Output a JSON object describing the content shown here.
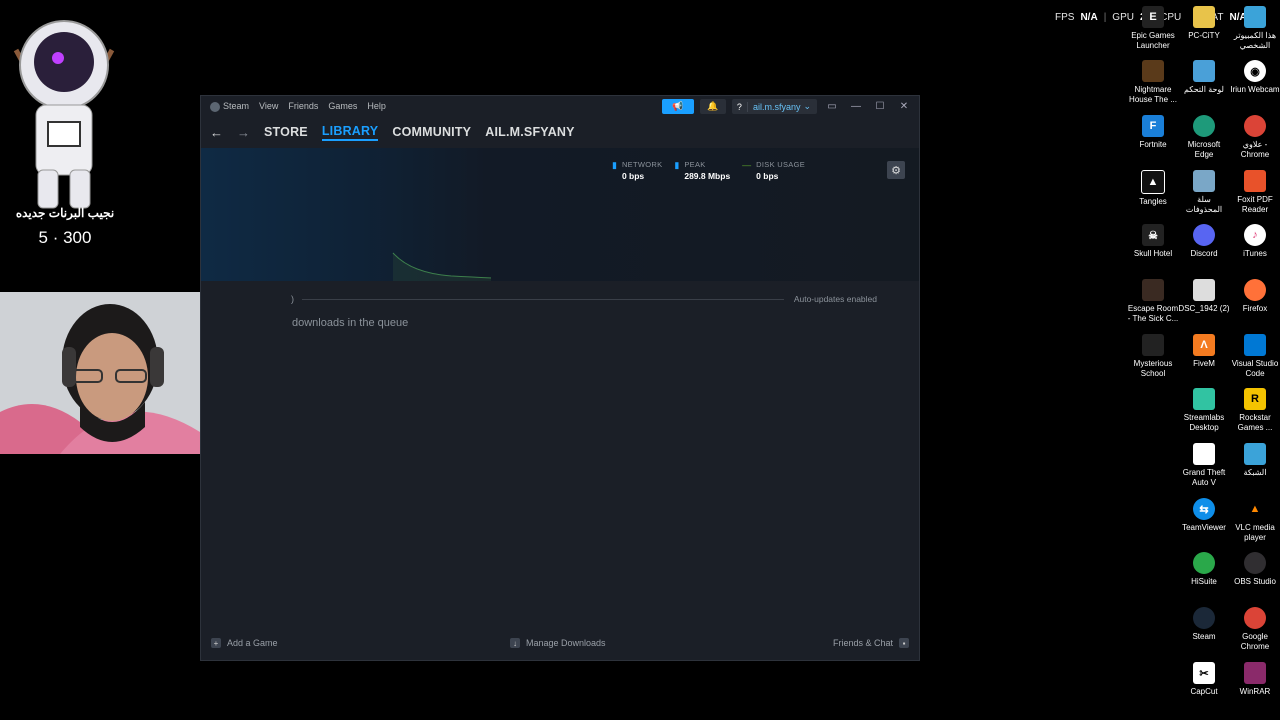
{
  "overlay": {
    "fps_label": "FPS",
    "fps_value": "N/A",
    "gpu_label": "GPU",
    "gpu_value": "2",
    "cpu_label": "CPU",
    "lat_label": "LAT",
    "lat_value": "N/A"
  },
  "mascot": {
    "caption": "نجيب البرنات جديده",
    "count": "5 · 300"
  },
  "steam": {
    "menu": [
      "Steam",
      "View",
      "Friends",
      "Games",
      "Help"
    ],
    "account": "ail.m.sfyany",
    "help": "?",
    "nav": {
      "store": "STORE",
      "library": "LIBRARY",
      "community": "COMMUNITY",
      "user": "AIL.M.SFYANY"
    },
    "stats": {
      "network_label": "NETWORK",
      "network_value": "0 bps",
      "peak_label": "PEAK",
      "peak_value": "289.8 Mbps",
      "disk_label": "DISK USAGE",
      "disk_value": "0 bps"
    },
    "queue": {
      "paren": ")",
      "auto_updates": "Auto-updates enabled",
      "message": "downloads in the queue"
    },
    "footer": {
      "add_game": "Add a Game",
      "manage_downloads": "Manage Downloads",
      "friends_chat": "Friends & Chat"
    }
  },
  "desktop": {
    "epic": "Epic Games Launcher",
    "pccity": "PC-CiTY",
    "mypc": "هذا الكمبيوتر الشخصي",
    "nightmare": "Nightmare House The ...",
    "control": "لوحة التحكم",
    "iriun": "Iriun Webcam",
    "fortnite": "Fortnite",
    "edge": "Microsoft Edge",
    "chrome_ar": "علاوي - Chrome",
    "tangles": "Tangles",
    "recycle": "سلة المحذوفات",
    "foxit": "Foxit PDF Reader",
    "skull": "Skull Hotel",
    "discord": "Discord",
    "itunes": "iTunes",
    "escape": "Escape Room - The Sick C...",
    "dsc": "DSC_1942 (2)",
    "firefox": "Firefox",
    "mysterious": "Mysterious School",
    "fivem": "FiveM",
    "vscode": "Visual Studio Code",
    "streamlabs": "Streamlabs Desktop",
    "rockstar": "Rockstar Games ...",
    "gta": "Grand Theft Auto V",
    "network": "الشبكة",
    "teamviewer": "TeamViewer",
    "vlc": "VLC media player",
    "hisuite": "HiSuite",
    "obs": "OBS Studio",
    "steam": "Steam",
    "chrome": "Google Chrome",
    "capcut": "CapCut",
    "winrar": "WinRAR"
  }
}
